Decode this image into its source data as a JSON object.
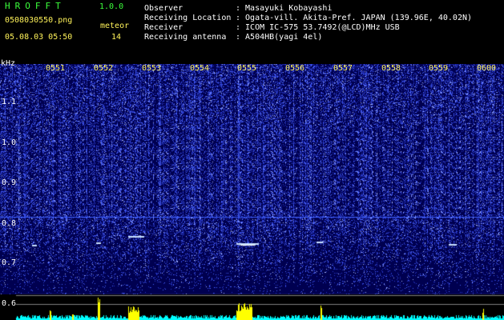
{
  "header": {
    "app_title": "HROFFT",
    "app_version": "1.0.0",
    "filename": "0508030550.png",
    "datetime": "05.08.03 05:50",
    "meteor_label": "meteor",
    "meteor_count": "14"
  },
  "meta": [
    {
      "label": "Observer",
      "value": ": Masayuki Kobayashi"
    },
    {
      "label": "Receiving Location",
      "value": ": Ogata-vill. Akita-Pref. JAPAN (139.96E, 40.02N)"
    },
    {
      "label": "Receiver",
      "value": ": ICOM IC-575 53.7492(@LCD)MHz USB"
    },
    {
      "label": "Receiving antenna",
      "value": ": A504HB(yagi 4el)"
    }
  ],
  "axis": {
    "unit": "kHz",
    "y_labels": [
      "1.1",
      "1.0",
      "0.9",
      "0.8",
      "0.7",
      "0.6"
    ],
    "time_labels": [
      "0551",
      "0552",
      "0553",
      "0554",
      "0555",
      "0556",
      "0557",
      "0558",
      "0559",
      "0600"
    ]
  },
  "colors": {
    "header_green": "#3cff3c",
    "header_white": "#ffffff",
    "time_label_yellow": "#fff35a",
    "spectrogram_background": "#000050",
    "signal_blue": "#3c5cff",
    "reference_line": "#4060ff",
    "activity_cyan": "#00ffff",
    "activity_yellow": "#ffff00"
  }
}
